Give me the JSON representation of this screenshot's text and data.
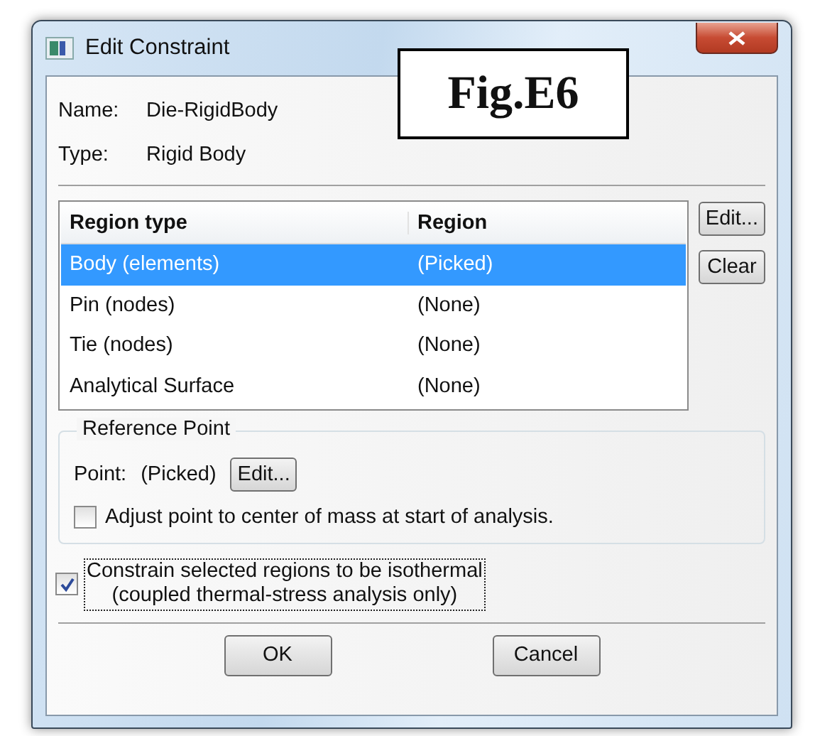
{
  "window": {
    "title": "Edit Constraint"
  },
  "figure_label": "Fig.E6",
  "fields": [
    {
      "label": "Name:",
      "value": "Die-RigidBody"
    },
    {
      "label": "Type:",
      "value": "Rigid Body"
    }
  ],
  "table": {
    "columns": [
      "Region type",
      "Region"
    ],
    "rows": [
      {
        "cells": [
          "Body (elements)",
          "(Picked)"
        ],
        "selected": true
      },
      {
        "cells": [
          "Pin (nodes)",
          "(None)"
        ],
        "selected": false
      },
      {
        "cells": [
          "Tie (nodes)",
          "(None)"
        ],
        "selected": false
      },
      {
        "cells": [
          "Analytical Surface",
          "(None)"
        ],
        "selected": false
      }
    ]
  },
  "side_buttons": [
    "Edit...",
    "Clear"
  ],
  "reference_point": {
    "title": "Reference Point",
    "label": "Point:",
    "value": "(Picked)",
    "button": "Edit...",
    "checkbox": {
      "label": "Adjust point to center of mass at start of analysis.",
      "checked": false
    }
  },
  "isothermal": {
    "lines": [
      "Constrain selected regions to be isothermal",
      "(coupled thermal-stress analysis only)"
    ],
    "checked": true
  },
  "buttons": [
    "OK",
    "Cancel"
  ]
}
